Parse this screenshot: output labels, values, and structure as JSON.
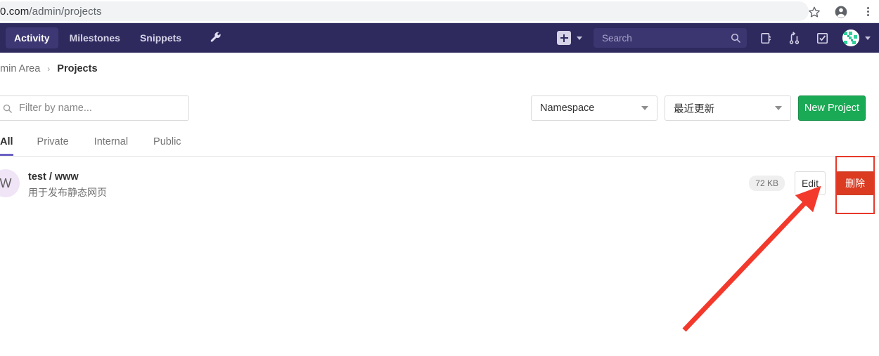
{
  "browser": {
    "url_host": "0.com",
    "url_path": "/admin/projects",
    "icons": [
      "bookmark-star-icon",
      "profile-icon",
      "more-menu-icon"
    ]
  },
  "navbar": {
    "links": [
      {
        "label": "Activity",
        "active": true
      },
      {
        "label": "Milestones",
        "active": false
      },
      {
        "label": "Snippets",
        "active": false
      }
    ],
    "wrench_icon": "wrench-icon",
    "plus_icon": "plus-icon",
    "search": {
      "placeholder": "Search",
      "icon": "search-icon"
    },
    "right_icons": [
      "issues-icon",
      "merge-requests-icon",
      "todos-icon"
    ],
    "avatar": "user-avatar",
    "bg_color": "#2e2a5e"
  },
  "breadcrumb": {
    "parent": "dmin Area",
    "separator": "›",
    "current": "Projects"
  },
  "filters": {
    "search_placeholder": "Filter by name...",
    "search_icon": "search-icon",
    "namespace_label": "Namespace",
    "sort_label": "最近更新",
    "new_project_label": "New Project",
    "new_project_color": "#1aaa55"
  },
  "tabs": [
    {
      "label": "All",
      "active": true
    },
    {
      "label": "Private",
      "active": false
    },
    {
      "label": "Internal",
      "active": false
    },
    {
      "label": "Public",
      "active": false
    }
  ],
  "active_tab_color": "#6b61c4",
  "projects": [
    {
      "avatar_letter": "W",
      "name": "test / www",
      "description": "用于发布静态网页",
      "size": "72 KB",
      "edit_label": "Edit",
      "delete_label": "删除"
    }
  ],
  "annotation": {
    "highlight_color": "#e8382a",
    "shapes": [
      "highlight-rectangle",
      "pointer-arrow"
    ]
  }
}
